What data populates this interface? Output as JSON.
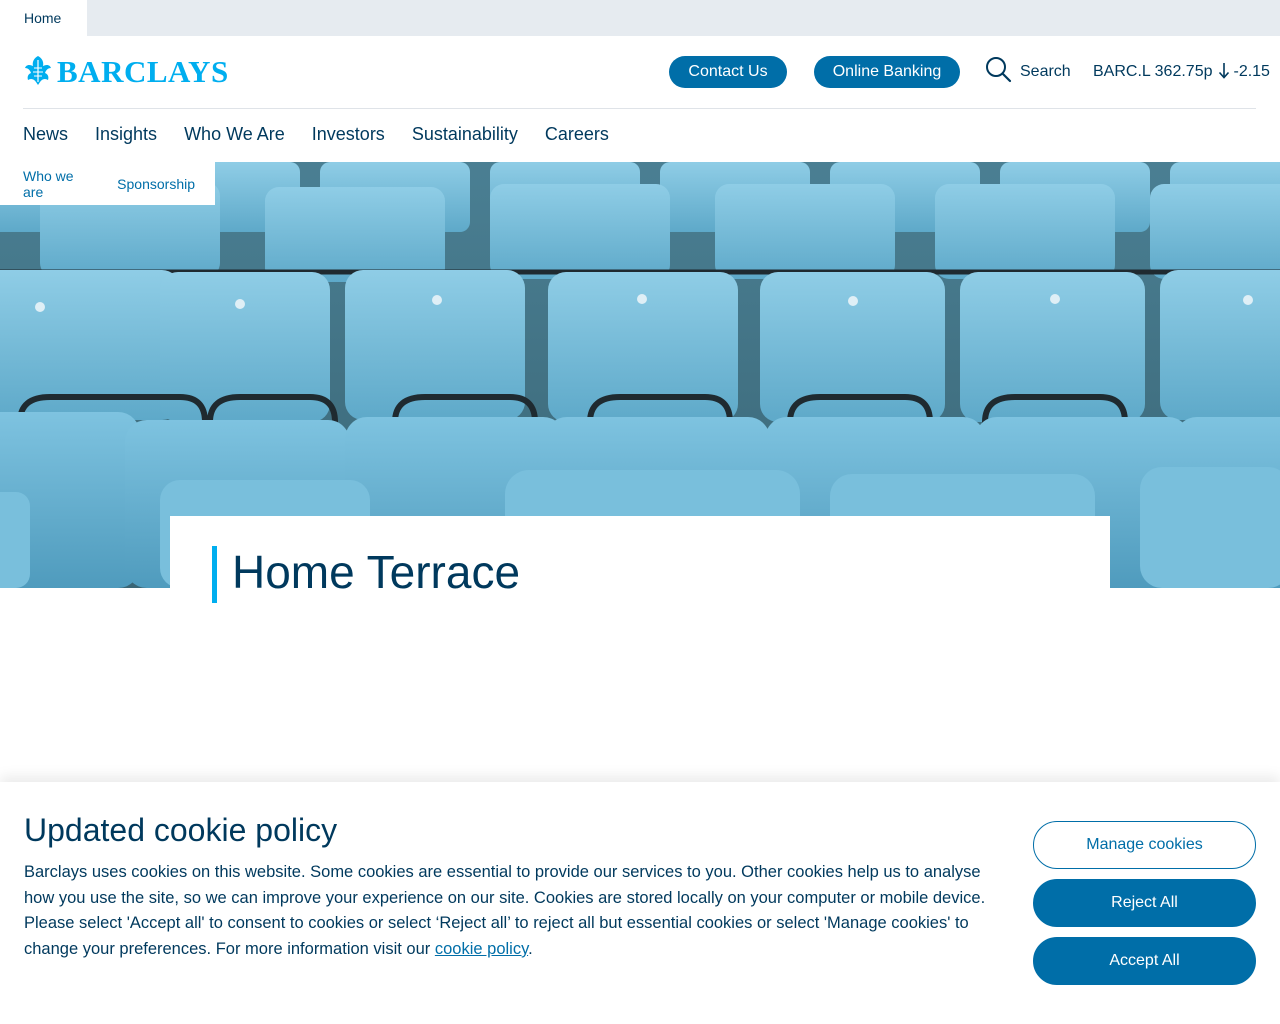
{
  "top_bar": {
    "tab_label": "Home"
  },
  "header": {
    "logo_text": "BARCLAYS",
    "contact_label": "Contact Us",
    "banking_label": "Online Banking",
    "search_label": "Search",
    "ticker": {
      "symbol_price": "BARC.L 362.75p",
      "change": "-2.15",
      "direction_icon": "arrow-down-icon"
    }
  },
  "nav": {
    "items": [
      {
        "label": "News"
      },
      {
        "label": "Insights"
      },
      {
        "label": "Who We Are"
      },
      {
        "label": "Investors"
      },
      {
        "label": "Sustainability"
      },
      {
        "label": "Careers"
      }
    ]
  },
  "breadcrumb": {
    "items": [
      {
        "label": "Who we are"
      },
      {
        "label": "Sponsorship"
      }
    ]
  },
  "page": {
    "title": "Home Terrace"
  },
  "cookie": {
    "title": "Updated cookie policy",
    "text": "Barclays uses cookies on this website. Some cookies are essential to provide our services to you. Other cookies help us to analyse how you use the site, so we can improve your experience on our site. Cookies are stored locally on your computer or mobile device. Please select 'Accept all' to consent to cookies or select ‘Reject all’ to reject all but essential cookies or select 'Manage cookies' to change your preferences. For more information visit our ",
    "link_text": "cookie policy",
    "text_end": ".",
    "manage_label": "Manage cookies",
    "reject_label": "Reject All",
    "accept_label": "Accept All"
  },
  "colors": {
    "brand": "#00aeef",
    "primary": "#006ea8",
    "navy": "#00395d"
  }
}
